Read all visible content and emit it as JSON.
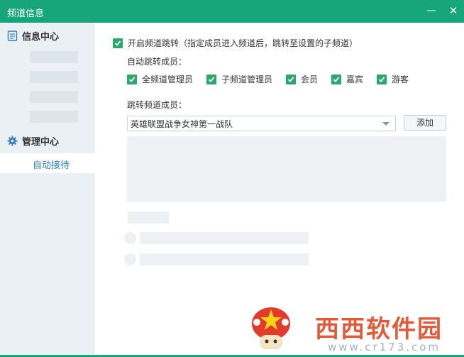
{
  "window": {
    "title": "频道信息",
    "minimize_glyph": "—",
    "close_glyph": "✕"
  },
  "sidebar": {
    "sections": [
      {
        "icon": "document-icon",
        "label": "信息中心"
      },
      {
        "icon": "gear-icon",
        "label": "管理中心"
      }
    ],
    "active_item": "自动接待"
  },
  "main": {
    "enable_redirect": {
      "checked": true,
      "label": "开启频道跳转（指定成员进入频道后，跳转至设置的子频道）"
    },
    "auto_redirect_label": "自动跳转成员：",
    "roles": [
      {
        "label": "全频道管理员",
        "checked": true
      },
      {
        "label": "子频道管理员",
        "checked": true
      },
      {
        "label": "会员",
        "checked": true
      },
      {
        "label": "嘉宾",
        "checked": true
      },
      {
        "label": "游客",
        "checked": true
      }
    ],
    "redirect_members_label": "跳转频道成员：",
    "member_select": {
      "value": "英雄联盟战争女神第一战队"
    },
    "add_button": "添加"
  },
  "watermark": {
    "brand": "西西软件园",
    "url": "www.cr173.com"
  },
  "colors": {
    "titlebar": "#17a57a",
    "checkbox": "#29a96c",
    "active_text": "#2a7fb8",
    "sidebar_bg": "#eaf0f4"
  }
}
